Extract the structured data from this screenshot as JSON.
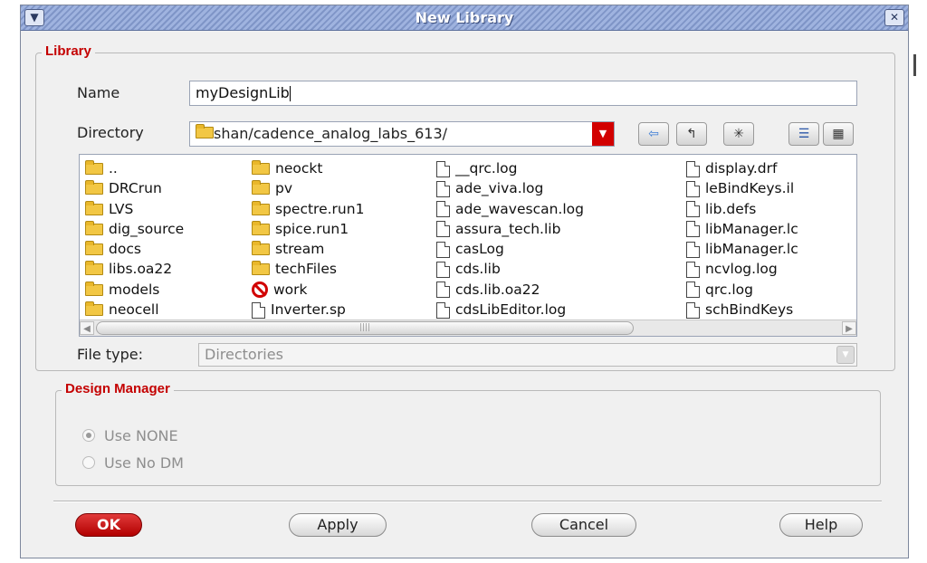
{
  "window": {
    "title": "New Library",
    "menu_icon": "chevron-down-icon",
    "close_icon": "close-icon"
  },
  "library": {
    "group_label": "Library",
    "name_label": "Name",
    "name_value": "myDesignLib",
    "directory_label": "Directory",
    "directory_value": "shan/cadence_analog_labs_613/",
    "toolbar_icons": [
      "back-arrow-icon",
      "parent-folder-icon",
      "new-folder-icon",
      "detail-view-icon",
      "list-view-icon"
    ],
    "columns": [
      [
        {
          "name": "..",
          "icon": "folder"
        },
        {
          "name": "DRCrun",
          "icon": "folder"
        },
        {
          "name": "LVS",
          "icon": "folder"
        },
        {
          "name": "dig_source",
          "icon": "folder"
        },
        {
          "name": "docs",
          "icon": "folder"
        },
        {
          "name": "libs.oa22",
          "icon": "folder"
        },
        {
          "name": "models",
          "icon": "folder"
        },
        {
          "name": "neocell",
          "icon": "folder"
        }
      ],
      [
        {
          "name": "neockt",
          "icon": "folder"
        },
        {
          "name": "pv",
          "icon": "folder"
        },
        {
          "name": "spectre.run1",
          "icon": "folder"
        },
        {
          "name": "spice.run1",
          "icon": "folder"
        },
        {
          "name": "stream",
          "icon": "folder"
        },
        {
          "name": "techFiles",
          "icon": "folder"
        },
        {
          "name": "work",
          "icon": "no-access"
        },
        {
          "name": "Inverter.sp",
          "icon": "file"
        }
      ],
      [
        {
          "name": "__qrc.log",
          "icon": "file"
        },
        {
          "name": "ade_viva.log",
          "icon": "file"
        },
        {
          "name": "ade_wavescan.log",
          "icon": "file"
        },
        {
          "name": "assura_tech.lib",
          "icon": "file"
        },
        {
          "name": "casLog",
          "icon": "file"
        },
        {
          "name": "cds.lib",
          "icon": "file"
        },
        {
          "name": "cds.lib.oa22",
          "icon": "file"
        },
        {
          "name": "cdsLibEditor.log",
          "icon": "file"
        }
      ],
      [
        {
          "name": "display.drf",
          "icon": "file"
        },
        {
          "name": "leBindKeys.il",
          "icon": "file"
        },
        {
          "name": "lib.defs",
          "icon": "file"
        },
        {
          "name": "libManager.lc",
          "icon": "file"
        },
        {
          "name": "libManager.lc",
          "icon": "file"
        },
        {
          "name": "ncvlog.log",
          "icon": "file"
        },
        {
          "name": "qrc.log",
          "icon": "file"
        },
        {
          "name": "schBindKeys",
          "icon": "file"
        }
      ]
    ],
    "filetype_label": "File type:",
    "filetype_value": "Directories"
  },
  "design_manager": {
    "group_label": "Design Manager",
    "options": [
      {
        "label": "Use NONE",
        "selected": true
      },
      {
        "label": "Use No DM",
        "selected": false
      }
    ]
  },
  "buttons": {
    "ok": "OK",
    "apply": "Apply",
    "cancel": "Cancel",
    "help": "Help"
  },
  "colors": {
    "accent": "#c40000",
    "title_bar": "#8fa4d4"
  }
}
